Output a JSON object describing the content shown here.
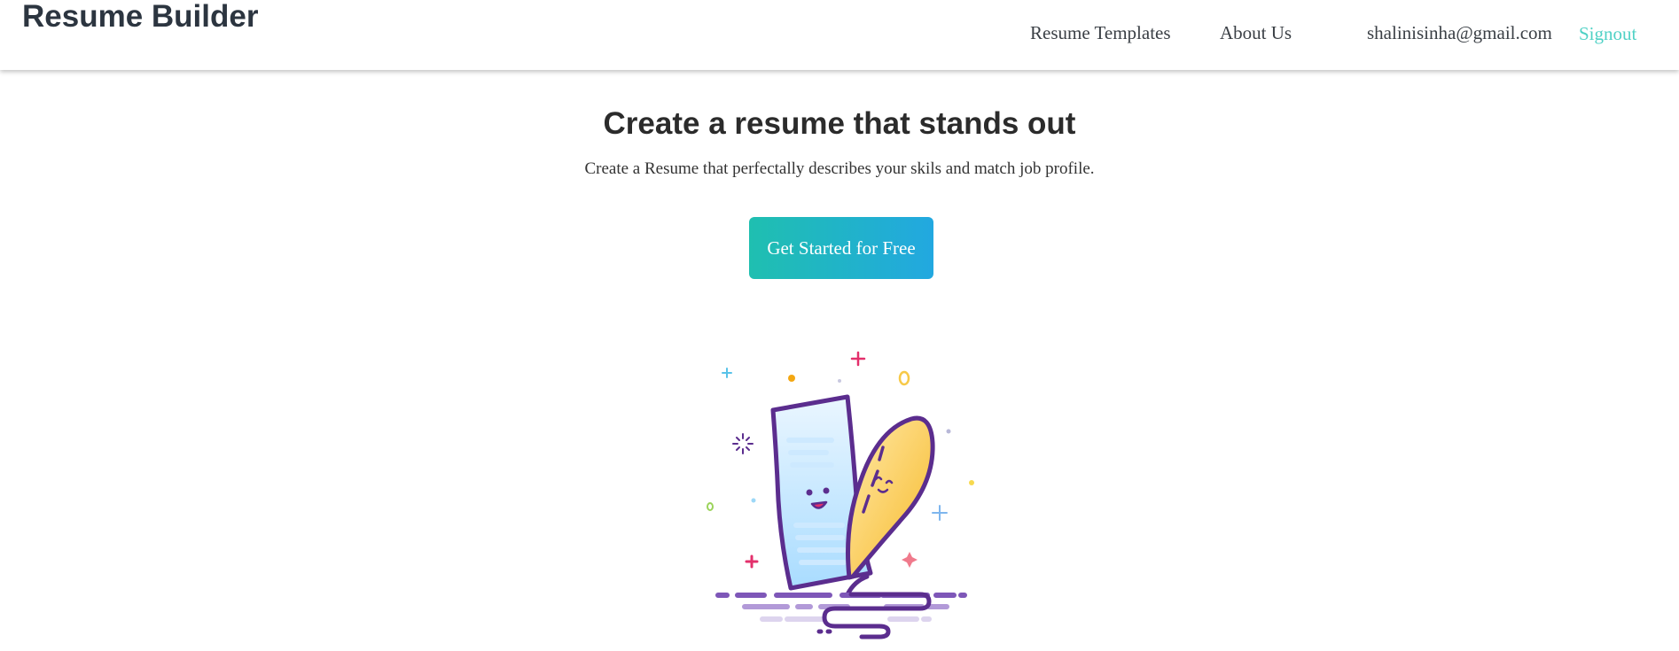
{
  "header": {
    "brand": "Resume Builder",
    "nav": {
      "templates": "Resume Templates",
      "about": "About Us",
      "email": "shalinisinha@gmail.com",
      "signout": "Signout"
    }
  },
  "hero": {
    "title": "Create a resume that stands out",
    "subtitle": "Create a Resume that perfectally describes your skils and match job profile.",
    "cta_label": "Get Started for Free"
  },
  "colors": {
    "brand_text": "#2c3540",
    "signout": "#4fd1c5",
    "cta_gradient_start": "#1fbfb0",
    "cta_gradient_end": "#22a8e0",
    "illustration_outline": "#5b2d8e"
  },
  "illustration": {
    "icon": "resume-quill-illustration"
  }
}
